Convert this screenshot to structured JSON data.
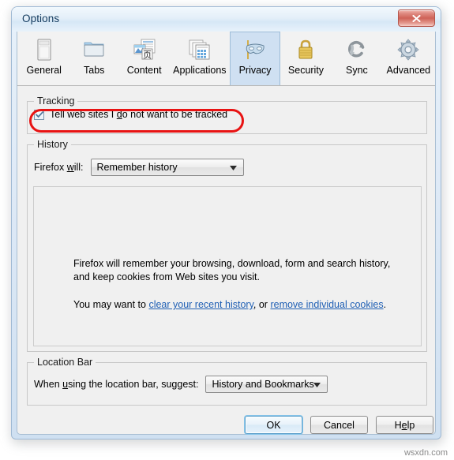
{
  "window": {
    "title": "Options",
    "close_icon": "close-x-icon"
  },
  "tabs": [
    {
      "id": "general",
      "label": "General",
      "icon": "window-pane-icon",
      "selected": false
    },
    {
      "id": "tabs",
      "label": "Tabs",
      "icon": "folder-icon",
      "selected": false
    },
    {
      "id": "content",
      "label": "Content",
      "icon": "content-page-icon",
      "selected": false
    },
    {
      "id": "applications",
      "label": "Applications",
      "icon": "applications-icon",
      "selected": false
    },
    {
      "id": "privacy",
      "label": "Privacy",
      "icon": "mask-icon",
      "selected": true
    },
    {
      "id": "security",
      "label": "Security",
      "icon": "padlock-icon",
      "selected": false
    },
    {
      "id": "sync",
      "label": "Sync",
      "icon": "sync-arrows-icon",
      "selected": false
    },
    {
      "id": "advanced",
      "label": "Advanced",
      "icon": "gear-icon",
      "selected": false
    }
  ],
  "tracking": {
    "legend": "Tracking",
    "checkbox": {
      "label_before": "Tell web sites I ",
      "label_accesskey": "d",
      "label_after": "o not want to be tracked",
      "checked": true
    },
    "highlight_color": "#e81313"
  },
  "history": {
    "legend": "History",
    "firefox_will_label_before": "Firefox ",
    "firefox_will_accesskey": "w",
    "firefox_will_label_after": "ill:",
    "combo_value": "Remember history",
    "paragraph1": "Firefox will remember your browsing, download, form and search history, and keep cookies from Web sites you visit.",
    "paragraph2_before": "You may want to ",
    "link1": "clear your recent history",
    "paragraph2_middle": ", or ",
    "link2": "remove individual cookies",
    "paragraph2_after": ".",
    "link_color": "#1f5fb4"
  },
  "location_bar": {
    "legend": "Location Bar",
    "label_before": "When ",
    "label_accesskey": "u",
    "label_after": "sing the location bar, suggest:",
    "combo_value": "History and Bookmarks"
  },
  "buttons": {
    "ok": "OK",
    "cancel": "Cancel",
    "help_before": "H",
    "help_accesskey": "e",
    "help_after": "lp"
  },
  "watermark": "wsxdn.com"
}
